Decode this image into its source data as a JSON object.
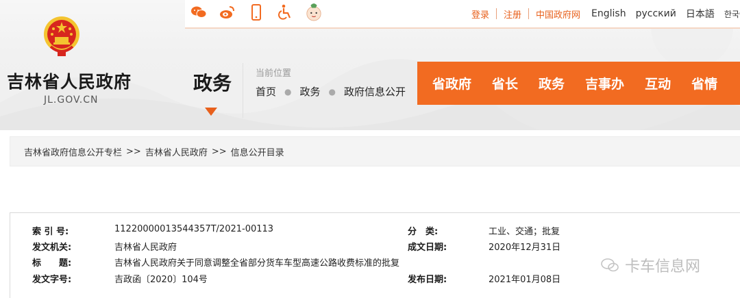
{
  "header": {
    "site_title": "吉林省人民政府",
    "site_domain": "JL.GOV.CN",
    "section_title": "政务",
    "social_icons": [
      "wechat-icon",
      "weibo-icon",
      "mobile-icon",
      "accessibility-icon",
      "mascot-icon"
    ]
  },
  "top_links": {
    "login": "登录",
    "register": "注册",
    "gov_net": "中国政府网",
    "languages": [
      "English",
      "русский",
      "日本語",
      "한국어"
    ]
  },
  "location": {
    "label": "当前位置",
    "links": [
      "首页",
      "政务",
      "政府信息公开"
    ]
  },
  "main_nav": {
    "items": [
      "省政府",
      "省长",
      "政务",
      "吉事办",
      "互动",
      "省情"
    ]
  },
  "breadcrumb": {
    "items": [
      "吉林省政府信息公开专栏",
      "吉林省人民政府",
      "信息公开目录"
    ],
    "separator": ">>"
  },
  "doc_info": {
    "index_label": "索 引 号:",
    "index_value": "11220000013544357T/2021-00113",
    "category_label": "分　类:",
    "category_value": "工业、交通；批复",
    "issuer_label": "发文机关:",
    "issuer_value": "吉林省人民政府",
    "created_label": "成文日期:",
    "created_value": "2020年12月31日",
    "title_label": "标　　题:",
    "title_value": "吉林省人民政府关于同意调整全省部分货车车型高速公路收费标准的批复",
    "docno_label": "发文字号:",
    "docno_value": "吉政函〔2020〕104号",
    "published_label": "发布日期:",
    "published_value": "2021年01月08日"
  },
  "watermark": {
    "text": "卡车信息网"
  },
  "colors": {
    "accent": "#f26b21",
    "link_orange": "#e8601c"
  }
}
